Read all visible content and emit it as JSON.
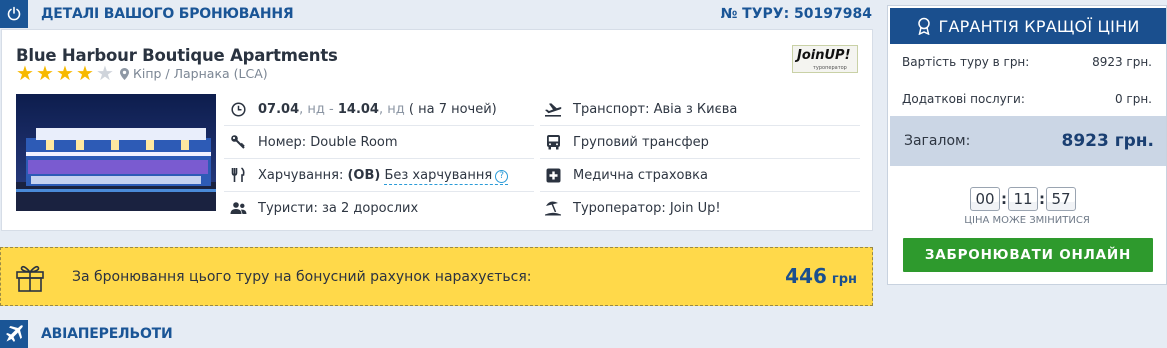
{
  "booking": {
    "section_title": "Деталі вашого бронювання",
    "tour_number": "№ ТУРУ: 50197984"
  },
  "hotel": {
    "name": "Blue Harbour Boutique Apartments",
    "stars_total": 5,
    "stars_filled": 4,
    "location": "Кіпр / Ларнака (LCA)",
    "operator_logo_text": "JoinUP!",
    "operator_logo_sub": "туроператор"
  },
  "details": {
    "date_from": "07.04",
    "day_from": "нд",
    "date_to": "14.04",
    "day_to": "нд",
    "nights": "( на 7 ночей)",
    "room": "Номер: Double Room",
    "meal_label": "Харчування: ",
    "meal_code": "(OB)",
    "meal_name": "Без харчування",
    "meal_help": "?",
    "tourists": "Туристи: за 2 дорослих",
    "transport": "Транспорт: Авіа з Києва",
    "transfer": "Груповий трансфер",
    "insurance": "Медична страховка",
    "operator": "Туроператор: Join Up!"
  },
  "bonus": {
    "text": "За бронювання цього туру на бонусний рахунок нарахується:",
    "amount": "446",
    "currency": "грн"
  },
  "flights": {
    "section_title": "Авіаперельоти"
  },
  "price_panel": {
    "guarantee": "Гарантія кращої ціни",
    "tour_cost_label": "Вартість туру в грн:",
    "tour_cost_value": "8923 грн.",
    "extra_label": "Додаткові послуги:",
    "extra_value": "0 грн.",
    "total_label": "Загалом:",
    "total_value": "8923 грн.",
    "timer_h": "00",
    "timer_m": "11",
    "timer_s": "57",
    "timer_sep": ":",
    "price_may_change": "Ціна може змінитися",
    "book_button": "Забронювати онлайн"
  },
  "colors": {
    "brand_blue": "#1a4f8e",
    "bonus_yellow": "#ffd94a",
    "book_green": "#2e9a2d",
    "star": "#f7b900"
  }
}
